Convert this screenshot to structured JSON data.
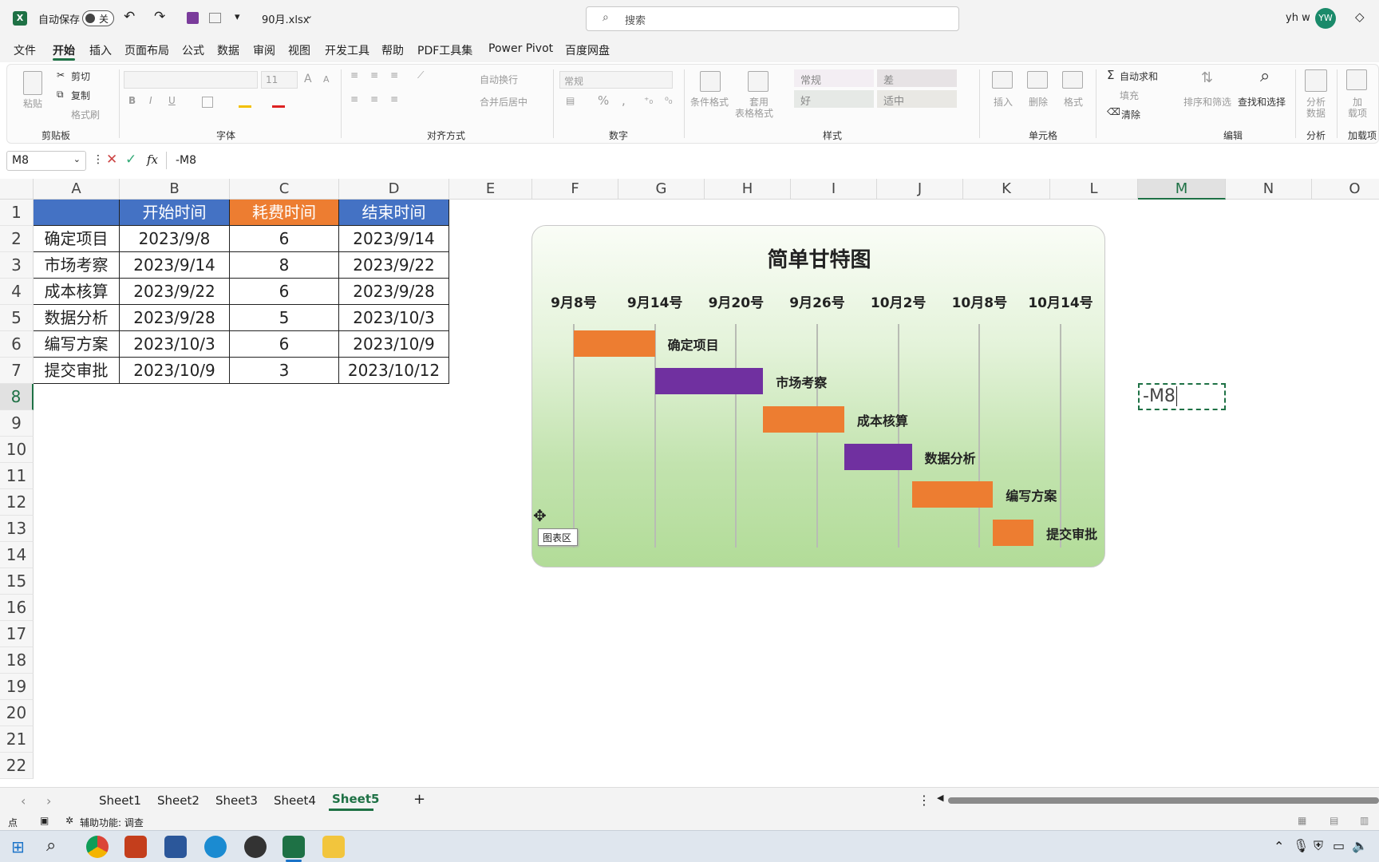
{
  "titlebar": {
    "autosave_label": "自动保存",
    "autosave_state": "关",
    "filename": "90月.xlsx",
    "search_placeholder": "搜索",
    "user_name": "yh w",
    "user_initials": "YW"
  },
  "menu": {
    "tabs": [
      "文件",
      "开始",
      "插入",
      "页面布局",
      "公式",
      "数据",
      "审阅",
      "视图",
      "开发工具",
      "帮助",
      "PDF工具集",
      "Power Pivot",
      "百度网盘"
    ],
    "active": "开始"
  },
  "ribbon": {
    "clipboard": {
      "paste": "粘贴",
      "cut": "剪切",
      "copy": "复制",
      "format_painter": "格式刷",
      "group": "剪贴板"
    },
    "font": {
      "font_size": "11",
      "group": "字体"
    },
    "alignment": {
      "wrap": "自动换行",
      "merge": "合并后居中",
      "group": "对齐方式"
    },
    "number": {
      "format": "常规",
      "group": "数字"
    },
    "styles": {
      "conditional": "条件格式",
      "table_format_1": "套用",
      "table_format_2": "表格格式",
      "normal": "常规",
      "bad": "差",
      "good": "好",
      "neutral": "适中",
      "group": "样式"
    },
    "cells": {
      "insert": "插入",
      "delete": "删除",
      "format": "格式",
      "group": "单元格"
    },
    "editing": {
      "autosum": "自动求和",
      "fill": "填充",
      "clear": "清除",
      "sort": "排序和筛选",
      "find": "查找和选择",
      "group": "编辑"
    },
    "analysis": {
      "analyze_1": "分析",
      "analyze_2": "数据",
      "group": "分析"
    },
    "addins": {
      "addins_1": "加",
      "addins_2": "载项",
      "group": "加载项"
    }
  },
  "formula_bar": {
    "name_box": "M8",
    "fx": "fx",
    "formula": "-M8"
  },
  "columns": [
    "A",
    "B",
    "C",
    "D",
    "E",
    "F",
    "G",
    "H",
    "I",
    "J",
    "K",
    "L",
    "M",
    "N",
    "O"
  ],
  "selected_column": "M",
  "rows": [
    "1",
    "2",
    "3",
    "4",
    "5",
    "6",
    "7",
    "8",
    "9",
    "10",
    "11",
    "12",
    "13",
    "14",
    "15",
    "16",
    "17",
    "18",
    "19",
    "20",
    "21",
    "22"
  ],
  "selected_row": "8",
  "table": {
    "headers": [
      "",
      "开始时间",
      "耗费时间",
      "结束时间"
    ],
    "rows": [
      [
        "确定项目",
        "2023/9/8",
        "6",
        "2023/9/14"
      ],
      [
        "市场考察",
        "2023/9/14",
        "8",
        "2023/9/22"
      ],
      [
        "成本核算",
        "2023/9/22",
        "6",
        "2023/9/28"
      ],
      [
        "数据分析",
        "2023/9/28",
        "5",
        "2023/10/3"
      ],
      [
        "编写方案",
        "2023/10/3",
        "6",
        "2023/10/9"
      ],
      [
        "提交审批",
        "2023/10/9",
        "3",
        "2023/10/12"
      ]
    ]
  },
  "edit_cell": {
    "value": "-M8"
  },
  "chart_tooltip": "图表区",
  "chart_data": {
    "type": "bar",
    "orientation": "horizontal-gantt",
    "title": "简单甘特图",
    "x_tick_labels": [
      "9月8号",
      "9月14号",
      "9月20号",
      "9月26号",
      "10月2号",
      "10月8号",
      "10月14号"
    ],
    "x_ticks": [
      "2023-09-08",
      "2023-09-14",
      "2023-09-20",
      "2023-09-26",
      "2023-10-02",
      "2023-10-08",
      "2023-10-14"
    ],
    "xlim": [
      "2023-09-08",
      "2023-10-14"
    ],
    "grid": true,
    "categories": [
      "确定项目",
      "市场考察",
      "成本核算",
      "数据分析",
      "编写方案",
      "提交审批"
    ],
    "start": [
      "2023-09-08",
      "2023-09-14",
      "2023-09-22",
      "2023-09-28",
      "2023-10-03",
      "2023-10-09"
    ],
    "duration_days": [
      6,
      8,
      6,
      5,
      6,
      3
    ],
    "colors": [
      "#ed7d31",
      "#7030a0",
      "#ed7d31",
      "#7030a0",
      "#ed7d31",
      "#ed7d31"
    ]
  },
  "sheets": [
    "Sheet1",
    "Sheet2",
    "Sheet3",
    "Sheet4",
    "Sheet5"
  ],
  "active_sheet": "Sheet5",
  "status": {
    "mode": "点",
    "accessibility": "辅助功能: 调查"
  }
}
